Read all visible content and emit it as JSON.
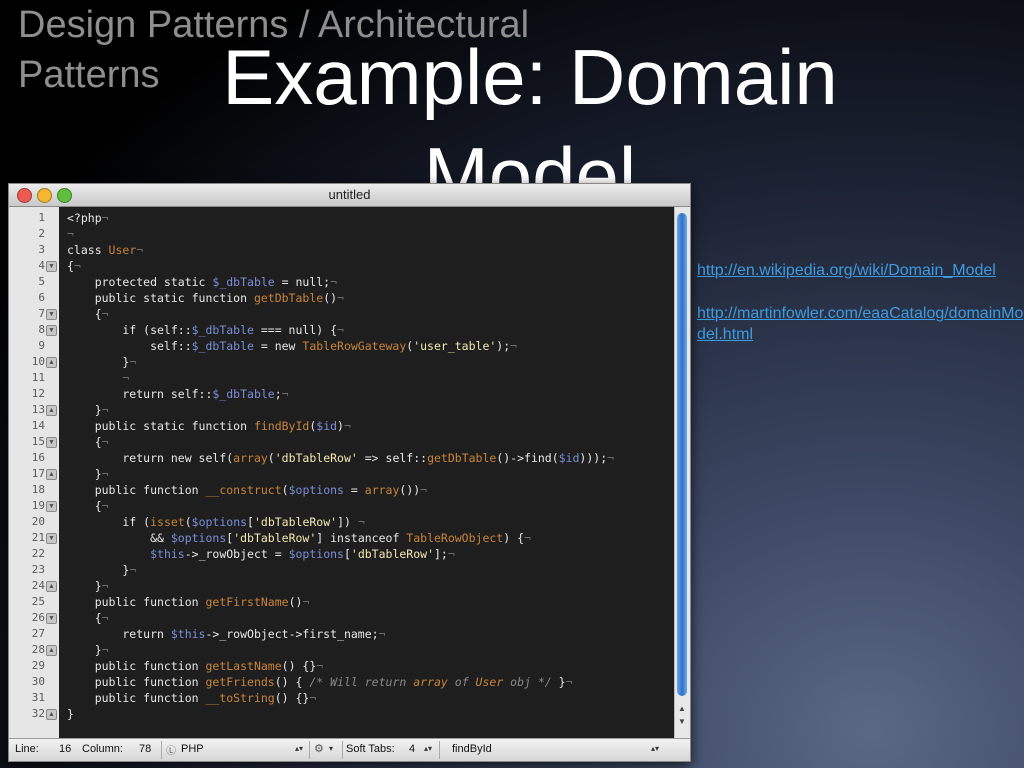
{
  "slide": {
    "breadcrumb": "Design Patterns / Architectural Patterns",
    "title": "Example: Domain Model",
    "links": [
      "http://en.wikipedia.org/wiki/Domain_Model",
      "http://martinfowler.com/eaaCatalog/domainModel.html"
    ]
  },
  "editor": {
    "window_title": "untitled",
    "line_numbers": [
      "1",
      "2",
      "3",
      "4",
      "5",
      "6",
      "7",
      "8",
      "9",
      "10",
      "11",
      "12",
      "13",
      "14",
      "15",
      "16",
      "17",
      "18",
      "19",
      "20",
      "21",
      "22",
      "23",
      "24",
      "25",
      "26",
      "27",
      "28",
      "29",
      "30",
      "31",
      "32"
    ],
    "code_lines": [
      "<?php¬",
      "¬",
      "class User¬",
      "{¬",
      "    protected static $_dbTable = null;¬",
      "    public static function getDbTable()¬",
      "    {¬",
      "        if (self::$_dbTable === null) {¬",
      "            self::$_dbTable = new TableRowGateway('user_table');¬",
      "        }¬",
      "        ¬",
      "        return self::$_dbTable;¬",
      "    }¬",
      "    public static function findById($id)¬",
      "    {¬",
      "        return new self(array('dbTableRow' => self::getDbTable()->find($id)));¬",
      "    }¬",
      "    public function __construct($options = array())¬",
      "    {¬",
      "        if (isset($options['dbTableRow']) ¬",
      "            && $options['dbTableRow'] instanceof TableRowObject) {¬",
      "            $this->_rowObject = $options['dbTableRow'];¬",
      "        }¬",
      "    }¬",
      "    public function getFirstName()¬",
      "    {¬",
      "        return $this->_rowObject->first_name;¬",
      "    }¬",
      "    public function getLastName() {}¬",
      "    public function getFriends() { /* Will return array of User obj */ }¬",
      "    public function __toString() {}¬",
      "}"
    ],
    "status": {
      "line_label": "Line:",
      "line_value": "16",
      "column_label": "Column:",
      "column_value": "78",
      "language": "PHP",
      "soft_tabs_label": "Soft Tabs:",
      "soft_tabs_value": "4",
      "symbol": "findById"
    }
  }
}
